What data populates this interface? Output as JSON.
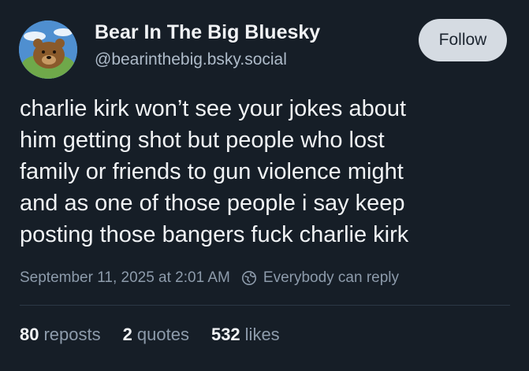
{
  "author": {
    "display_name": "Bear In The Big Bluesky",
    "handle": "@bearinthebig.bsky.social",
    "avatar_icon": "bear-avatar"
  },
  "follow_button": {
    "label": "Follow"
  },
  "post": {
    "text_lines": [
      "charlie kirk won’t see your jokes about",
      "him getting shot but people who lost",
      "family or friends to gun violence might",
      "and as one of those people i say keep",
      "posting those bangers fuck charlie kirk"
    ],
    "timestamp": "September 11, 2025 at 2:01 AM",
    "reply_setting": "Everybody can reply",
    "reply_icon": "globe-icon"
  },
  "stats": {
    "reposts": {
      "count": "80",
      "label": "reposts"
    },
    "quotes": {
      "count": "2",
      "label": "quotes"
    },
    "likes": {
      "count": "532",
      "label": "likes"
    }
  },
  "colors": {
    "background": "#161e27",
    "text": "#f1f3f5",
    "muted": "#8d9bab",
    "button_bg": "#d5dbe2"
  }
}
